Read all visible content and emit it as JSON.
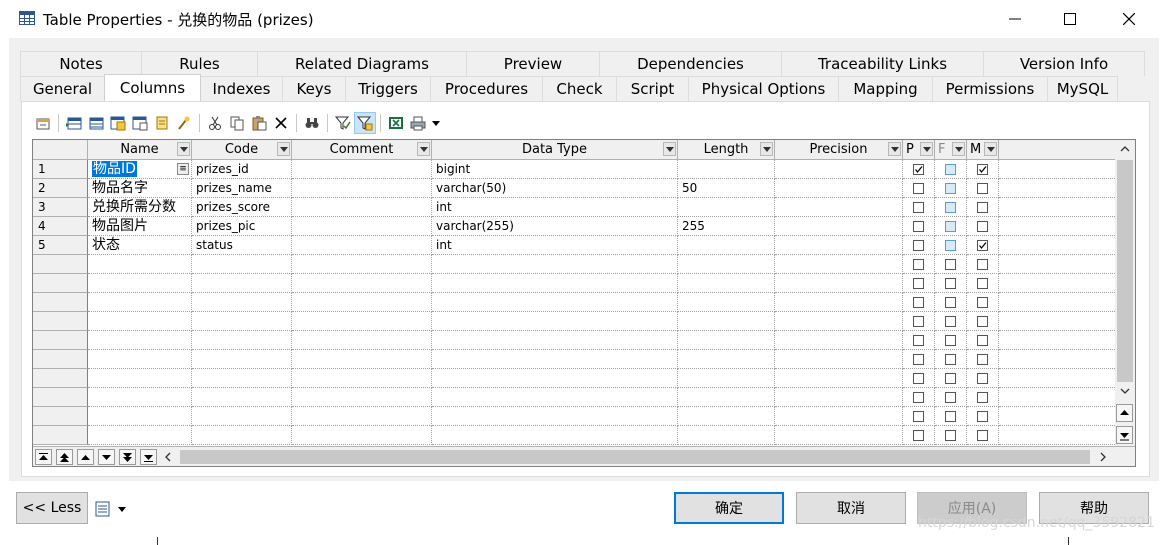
{
  "window": {
    "title": "Table Properties - 兑换的物品 (prizes)",
    "minimize_glyph": "—",
    "maximize_glyph": "☐",
    "close_glyph": "✕"
  },
  "tabs": {
    "row1": [
      {
        "label": "Notes"
      },
      {
        "label": "Rules"
      },
      {
        "label": "Related Diagrams"
      },
      {
        "label": "Preview"
      },
      {
        "label": "Dependencies"
      },
      {
        "label": "Traceability Links"
      },
      {
        "label": "Version Info"
      }
    ],
    "row2": [
      {
        "label": "General"
      },
      {
        "label": "Columns",
        "active": true
      },
      {
        "label": "Indexes"
      },
      {
        "label": "Keys"
      },
      {
        "label": "Triggers"
      },
      {
        "label": "Procedures"
      },
      {
        "label": "Check"
      },
      {
        "label": "Script"
      },
      {
        "label": "Physical Options"
      },
      {
        "label": "Mapping"
      },
      {
        "label": "Permissions"
      },
      {
        "label": "MySQL"
      }
    ]
  },
  "toolbar": {
    "icons": [
      "properties-icon",
      "insert-row-icon",
      "add-row-icon",
      "add-columns-icon",
      "add-domain-icon",
      "new-icon",
      "cut-icon",
      "copy-icon",
      "paste-icon",
      "delete-icon",
      "find-icon",
      "filter-icon",
      "customize-columns-icon",
      "excel-export-icon",
      "print-icon",
      "dropdown-icon"
    ]
  },
  "grid": {
    "headers": {
      "name": "Name",
      "code": "Code",
      "comment": "Comment",
      "datatype": "Data Type",
      "length": "Length",
      "precision": "Precision",
      "p": "P",
      "f": "F",
      "m": "M"
    },
    "rows": [
      {
        "num": "1",
        "name": "物品ID",
        "code": "prizes_id",
        "comment": "",
        "datatype": "bigint",
        "length": "",
        "precision": "",
        "p": true,
        "f": false,
        "m": true
      },
      {
        "num": "2",
        "name": "物品名字",
        "code": "prizes_name",
        "comment": "",
        "datatype": "varchar(50)",
        "length": "50",
        "precision": "",
        "p": false,
        "f": false,
        "m": false
      },
      {
        "num": "3",
        "name": "兑换所需分数",
        "code": "prizes_score",
        "comment": "",
        "datatype": "int",
        "length": "",
        "precision": "",
        "p": false,
        "f": false,
        "m": false
      },
      {
        "num": "4",
        "name": "物品图片",
        "code": "prizes_pic",
        "comment": "",
        "datatype": "varchar(255)",
        "length": "255",
        "precision": "",
        "p": false,
        "f": false,
        "m": false
      },
      {
        "num": "5",
        "name": "状态",
        "code": "status",
        "comment": "",
        "datatype": "int",
        "length": "",
        "precision": "",
        "p": false,
        "f": false,
        "m": true
      }
    ],
    "empty_rows": 10
  },
  "buttons": {
    "less": "<< Less",
    "ok": "确定",
    "cancel": "取消",
    "apply": "应用(A)",
    "help": "帮助"
  },
  "watermark": "https://blog.csdn.net/qq_3592821",
  "colors": {
    "selection": "#0078d7",
    "default_button_border": "#0078d7",
    "f_checkbox": "#d7eaf8"
  }
}
